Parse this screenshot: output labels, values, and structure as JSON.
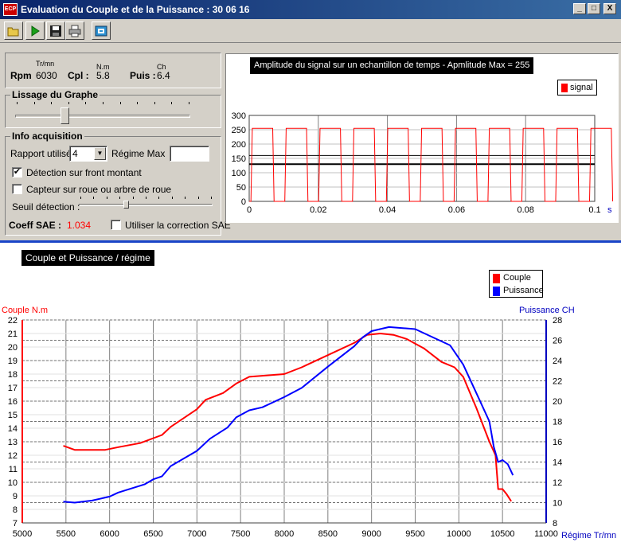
{
  "window": {
    "title": "Evaluation du Couple et de la Puissance : 30 06 16",
    "app_icon_text": "ECP",
    "controls": {
      "minimize": "_",
      "maximize": "□",
      "close": "X"
    }
  },
  "toolbar": {
    "buttons": [
      "open-folder-icon",
      "play-icon",
      "save-disk-icon",
      "print-icon",
      "export-icon"
    ]
  },
  "readout": {
    "rpm_label": "Rpm",
    "rpm_unit": "Tr/mn",
    "rpm_value": "6030",
    "cpl_label": "Cpl :",
    "cpl_unit": "N.m",
    "cpl_value": "5.8",
    "puis_label": "Puis :",
    "puis_unit": "Ch",
    "puis_value": "6.4"
  },
  "smoothing": {
    "title": "Lissage du Graphe",
    "level": 0.27
  },
  "acquisition": {
    "title": "Info acquisition",
    "rapport_label": "Rapport utilisé",
    "rapport_value": "4",
    "regime_max_label": "Régime Max",
    "regime_max_value": "",
    "front_montant_label": "Détection sur front montant",
    "front_montant_checked": true,
    "capteur_label": "Capteur sur roue ou arbre de roue",
    "capteur_checked": false,
    "seuil_label": "Seuil détection :",
    "seuil_level": 0.35,
    "coeff_label": "Coeff SAE :",
    "coeff_value": "1.034",
    "correction_label": "Utiliser la correction SAE",
    "correction_checked": false
  },
  "signal_chart": {
    "title": "Amplitude du signal sur un echantillon de temps - Apmlitude Max = 255",
    "legend": "signal",
    "x_unit": "s",
    "x_ticks": [
      "0",
      "0.02",
      "0.04",
      "0.06",
      "0.08",
      "0.1"
    ],
    "y_ticks": [
      "0",
      "50",
      "100",
      "150",
      "200",
      "250",
      "300"
    ],
    "color": "#ff0000"
  },
  "chart_data": {
    "type": "line",
    "title": "Couple et Puissance / régime",
    "xlabel": "Régime Tr/mn",
    "ylabel": "Couple N.m",
    "y2label": "Puissance CH",
    "xlim": [
      5000,
      11000
    ],
    "ylim": [
      7,
      22
    ],
    "y2lim": [
      8,
      28
    ],
    "x_ticks": [
      "5000",
      "5500",
      "6000",
      "6500",
      "7000",
      "7500",
      "8000",
      "8500",
      "9000",
      "9500",
      "10000",
      "10500",
      "11000"
    ],
    "y_ticks": [
      "7",
      "8",
      "9",
      "10",
      "11",
      "12",
      "13",
      "14",
      "15",
      "16",
      "17",
      "18",
      "19",
      "20",
      "21",
      "22"
    ],
    "y2_ticks": [
      "8",
      "10",
      "12",
      "14",
      "16",
      "18",
      "20",
      "22",
      "24",
      "26",
      "28"
    ],
    "legend_position": "top-right",
    "series": [
      {
        "name": "Couple",
        "color": "#ff0000",
        "axis": "left",
        "x": [
          5470,
          5600,
          5800,
          5950,
          6100,
          6350,
          6600,
          6700,
          7000,
          7100,
          7300,
          7450,
          7600,
          8000,
          8200,
          8500,
          8800,
          8950,
          9100,
          9250,
          9400,
          9600,
          9800,
          9950,
          10050,
          10200,
          10350,
          10420,
          10450,
          10500,
          10550,
          10600
        ],
        "y": [
          12.7,
          12.4,
          12.4,
          12.4,
          12.6,
          12.9,
          13.5,
          14.1,
          15.4,
          16.1,
          16.6,
          17.3,
          17.8,
          18.0,
          18.5,
          19.4,
          20.3,
          20.9,
          21.0,
          20.9,
          20.6,
          19.9,
          18.9,
          18.5,
          17.8,
          15.5,
          13.0,
          12.0,
          9.5,
          9.5,
          9.1,
          8.6
        ]
      },
      {
        "name": "Puissance",
        "color": "#0000ff",
        "axis": "right",
        "x": [
          5470,
          5600,
          5800,
          6000,
          6100,
          6400,
          6500,
          6600,
          6700,
          7000,
          7150,
          7350,
          7450,
          7600,
          7750,
          8000,
          8200,
          8500,
          8800,
          8900,
          9000,
          9200,
          9500,
          9600,
          9900,
          10050,
          10200,
          10350,
          10400,
          10450,
          10500,
          10560,
          10620
        ],
        "y": [
          10.1,
          10.0,
          10.2,
          10.6,
          11.0,
          11.8,
          12.3,
          12.6,
          13.6,
          15.1,
          16.3,
          17.4,
          18.4,
          19.1,
          19.4,
          20.4,
          21.3,
          23.4,
          25.4,
          26.3,
          26.9,
          27.3,
          27.1,
          26.7,
          25.5,
          23.6,
          20.8,
          18.0,
          15.5,
          14.0,
          14.2,
          13.8,
          12.7
        ]
      }
    ]
  }
}
